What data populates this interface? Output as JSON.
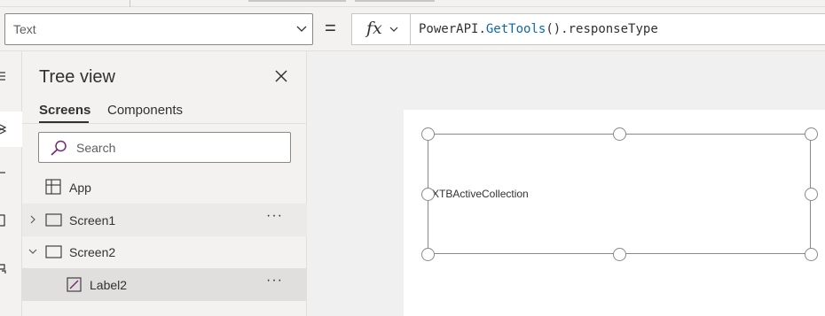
{
  "formula_bar": {
    "property": "Text",
    "equals": "=",
    "fx": "fx",
    "formula": {
      "object": "PowerAPI",
      "dot1": ".",
      "function": "GetTools",
      "rest": "().responseType"
    }
  },
  "tree_view": {
    "title": "Tree view",
    "tabs": {
      "screens": "Screens",
      "components": "Components"
    },
    "search_placeholder": "Search",
    "items": {
      "app": "App",
      "screen1": "Screen1",
      "screen2": "Screen2",
      "label2": "Label2"
    },
    "more": "···"
  },
  "canvas": {
    "label_text": "XTBActiveCollection"
  },
  "colors": {
    "accent": "#742774",
    "function_blue": "#0b6aa6"
  },
  "icons": [
    "chevron-down-icon",
    "fx-icon",
    "close-icon",
    "search-icon",
    "app-icon",
    "screen-icon",
    "chevron-right-icon",
    "label-edit-icon",
    "more-icon"
  ]
}
